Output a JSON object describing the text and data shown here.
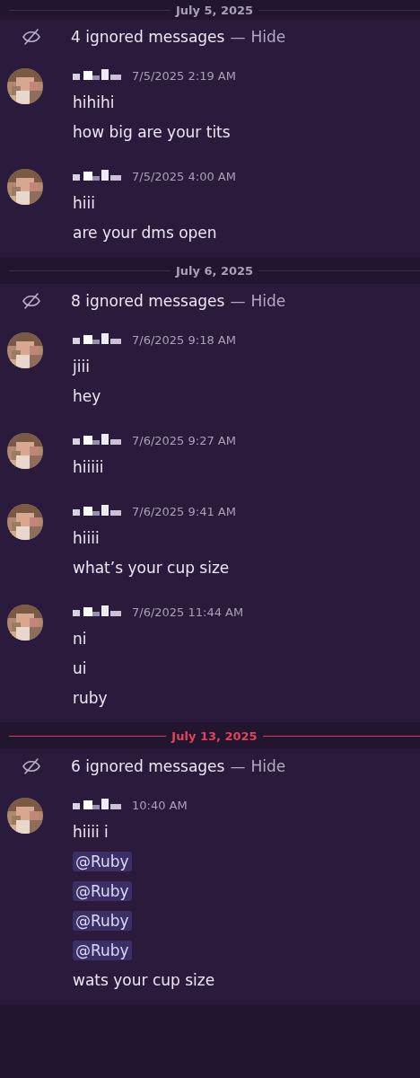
{
  "groups": [
    {
      "date": "July 5, 2025",
      "unread": false,
      "ignored": {
        "label": "4 ignored messages",
        "separator": "—",
        "action": "Hide"
      },
      "messages": [
        {
          "timestamp": "7/5/2025 2:19 AM",
          "lines": [
            {
              "kind": "text",
              "text": "hihihi"
            },
            {
              "kind": "text",
              "text": "how big are your tits"
            }
          ]
        },
        {
          "timestamp": "7/5/2025 4:00 AM",
          "lines": [
            {
              "kind": "text",
              "text": "hiii"
            },
            {
              "kind": "text",
              "text": "are your dms open"
            }
          ]
        }
      ]
    },
    {
      "date": "July 6, 2025",
      "unread": false,
      "ignored": {
        "label": "8 ignored messages",
        "separator": "—",
        "action": "Hide"
      },
      "messages": [
        {
          "timestamp": "7/6/2025 9:18 AM",
          "lines": [
            {
              "kind": "text",
              "text": "jiii"
            },
            {
              "kind": "text",
              "text": "hey"
            }
          ]
        },
        {
          "timestamp": "7/6/2025 9:27 AM",
          "lines": [
            {
              "kind": "text",
              "text": "hiiiii"
            }
          ]
        },
        {
          "timestamp": "7/6/2025 9:41 AM",
          "lines": [
            {
              "kind": "text",
              "text": "hiiii"
            },
            {
              "kind": "text",
              "text": "what’s your cup size"
            }
          ]
        },
        {
          "timestamp": "7/6/2025 11:44 AM",
          "lines": [
            {
              "kind": "text",
              "text": "ni"
            },
            {
              "kind": "text",
              "text": "ui"
            },
            {
              "kind": "text",
              "text": "ruby"
            }
          ]
        }
      ]
    },
    {
      "date": "July 13, 2025",
      "unread": true,
      "ignored": {
        "label": "6 ignored messages",
        "separator": "—",
        "action": "Hide"
      },
      "messages": [
        {
          "timestamp": "10:40 AM",
          "lines": [
            {
              "kind": "text",
              "text": "hiiii i"
            },
            {
              "kind": "mention",
              "text": "@Ruby"
            },
            {
              "kind": "mention",
              "text": "@Ruby"
            },
            {
              "kind": "mention",
              "text": "@Ruby"
            },
            {
              "kind": "mention",
              "text": "@Ruby"
            },
            {
              "kind": "text",
              "text": "wats your cup size"
            }
          ]
        }
      ]
    }
  ]
}
